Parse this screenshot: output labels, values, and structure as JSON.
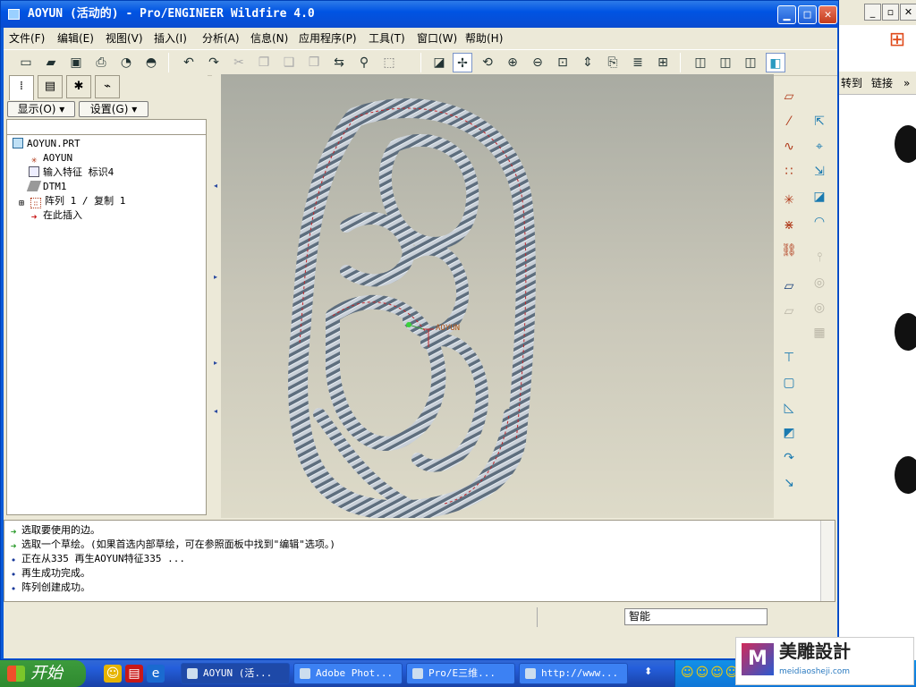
{
  "window": {
    "title": "AOYUN (活动的) - Pro/ENGINEER Wildfire 4.0",
    "min": "▁",
    "max": "□",
    "close": "✕"
  },
  "menu": [
    "文件(F)",
    "编辑(E)",
    "视图(V)",
    "插入(I)",
    "分析(A)",
    "信息(N)",
    "应用程序(P)",
    "工具(T)",
    "窗口(W)",
    "帮助(H)"
  ],
  "toolbar_icons": [
    "new-icon",
    "open-icon",
    "save-icon",
    "print-icon",
    "send-icon",
    "mail-icon",
    "undo-icon",
    "redo-icon",
    "cut-icon",
    "copy-icon",
    "paste-icon",
    "paste-special-icon",
    "regenerate-icon",
    "find-icon",
    "select-box-icon",
    "repaint-icon",
    "spin-center-icon",
    "orient-icon",
    "zoom-in-icon",
    "zoom-out-icon",
    "refit-icon",
    "reorient-icon",
    "view-manager-icon",
    "layers-icon",
    "model-tree-icon",
    "wireframe-icon",
    "hidden-line-icon",
    "no-hidden-icon",
    "shading-icon"
  ],
  "datum_toolbar": [
    "datum-planes-icon",
    "datum-axes-icon",
    "datum-points-icon",
    "coordinate-systems-icon",
    "spin-center-icon",
    "whats-this-icon"
  ],
  "panel": {
    "display_label": "显示(O)",
    "settings_label": "设置(G)",
    "tree": [
      {
        "label": "AOYUN.PRT",
        "icon": "part-icon"
      },
      {
        "label": "AOYUN",
        "icon": "csys-icon"
      },
      {
        "label": "输入特征 标识4",
        "icon": "import-feature-icon"
      },
      {
        "label": "DTM1",
        "icon": "datum-plane-icon"
      },
      {
        "label": "阵列 1 / 复制 1",
        "icon": "pattern-icon"
      },
      {
        "label": "在此插入",
        "icon": "insert-here-arrow-icon"
      }
    ]
  },
  "graphics": {
    "csys_label": "AOYUN",
    "bg_top": "#a9aba2",
    "bg_bottom": "#dedbc9",
    "model_color": "#6f7f8e",
    "edge_color": "#c0262a"
  },
  "messages": [
    {
      "text": "选取要使用的边。",
      "icon": "prompt-arrow-icon"
    },
    {
      "text": "选取一个草绘。(如果首选内部草绘，可在参照面板中找到\"编辑\"选项。)",
      "icon": "prompt-arrow-icon"
    },
    {
      "text": "正在从335 再生AOYUN特征335 ...",
      "icon": "info-bullet-icon"
    },
    {
      "text": "再生成功完成。",
      "icon": "info-bullet-icon"
    },
    {
      "text": "阵列创建成功。",
      "icon": "info-bullet-icon"
    }
  ],
  "status": {
    "filter": "智能"
  },
  "browser": {
    "link1": "转到",
    "link2": "链接",
    "more": "»"
  },
  "taskbar": {
    "start": "开始",
    "tasks": [
      "AOYUN (活...",
      "Adobe Phot...",
      "Pro/E三维...",
      "http://www..."
    ],
    "colors": {
      "bar": "#245edb",
      "start": "#3c9b3c",
      "tray": "#0f77d8"
    }
  },
  "logo": {
    "mark": "M",
    "text": "美雕設計",
    "sub": "meidiaosheji.com"
  }
}
